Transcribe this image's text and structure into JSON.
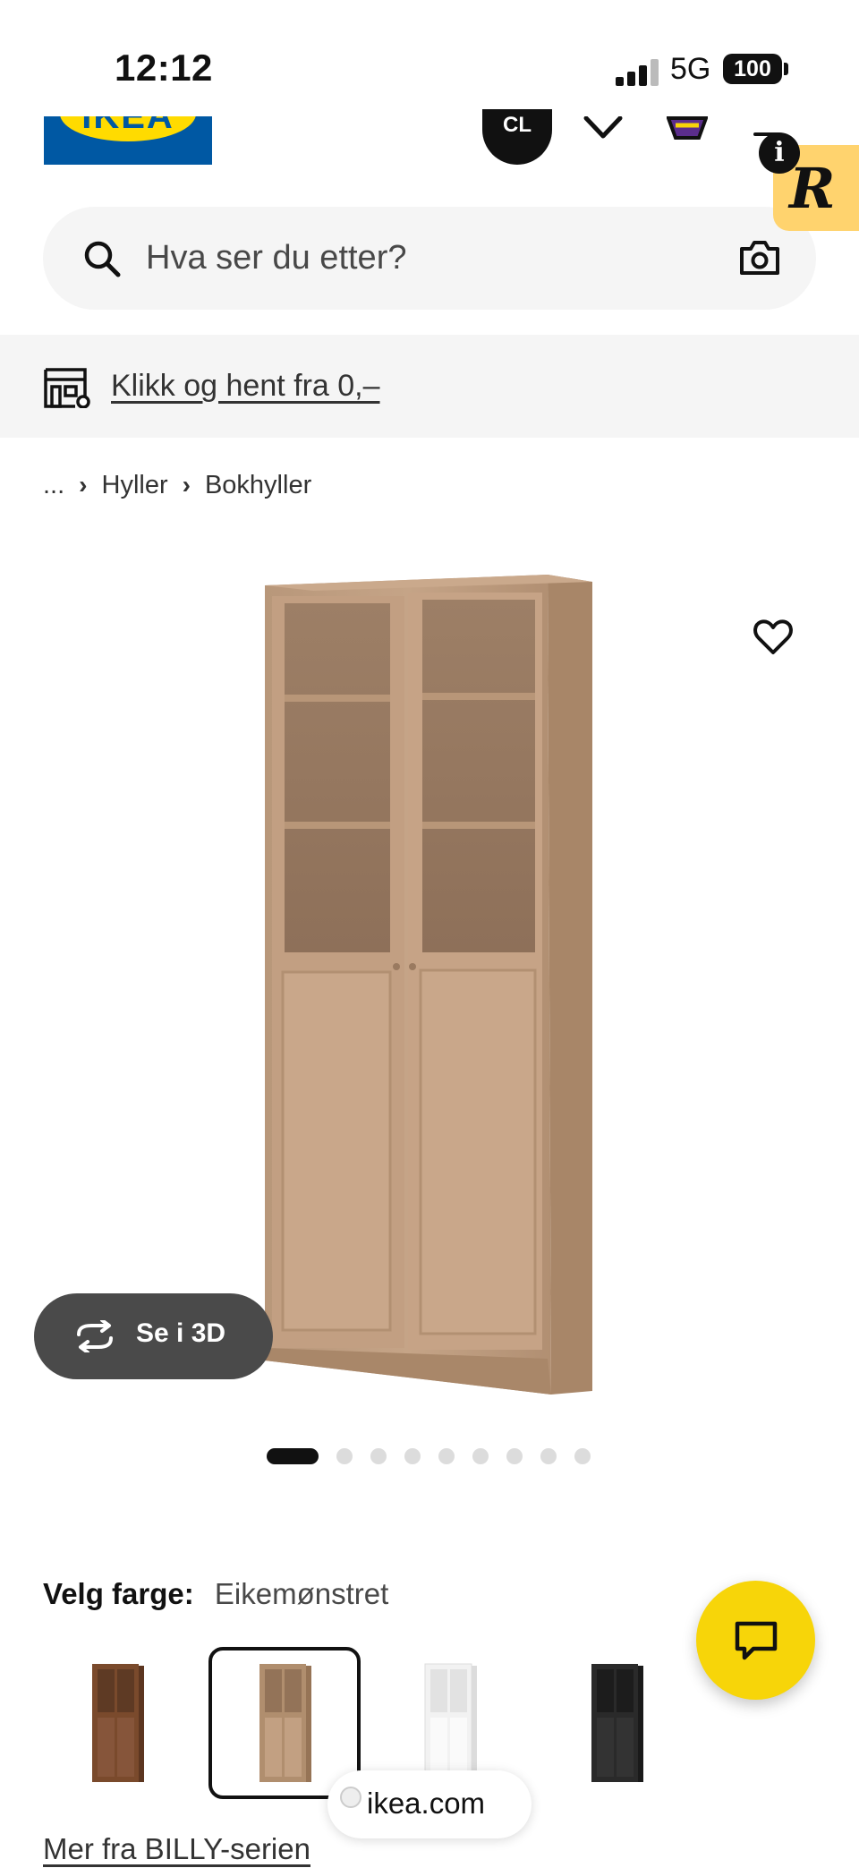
{
  "status_bar": {
    "time": "12:12",
    "network": "5G",
    "battery": "100"
  },
  "header": {
    "logo_text": "IKEA",
    "avatar_initials": "CL",
    "info_badge": "i",
    "widget_letter": "R"
  },
  "search": {
    "placeholder": "Hva ser du etter?"
  },
  "promo": {
    "link_text": "Klikk og hent fra 0,–"
  },
  "breadcrumb": {
    "ellipsis": "...",
    "items": [
      "Hyller",
      "Bokhyller"
    ]
  },
  "product": {
    "view3d_label": "Se i 3D",
    "image_count": 9,
    "active_image": 1
  },
  "color": {
    "label": "Velg farge:",
    "selected": "Eikemønstret",
    "swatches": [
      {
        "name": "brown-walnut",
        "color": "#7a4a2c"
      },
      {
        "name": "oak-pattern",
        "color": "#b08e6e",
        "selected": true
      },
      {
        "name": "white",
        "color": "#f4f4f4"
      },
      {
        "name": "black-brown",
        "color": "#2a2a2a"
      }
    ]
  },
  "series_link": "Mer fra BILLY-serien",
  "browser": {
    "url": "ikea.com"
  },
  "colors": {
    "brand_blue": "#0058a3",
    "brand_yellow": "#ffdb00",
    "chat_yellow": "#f7d509"
  }
}
